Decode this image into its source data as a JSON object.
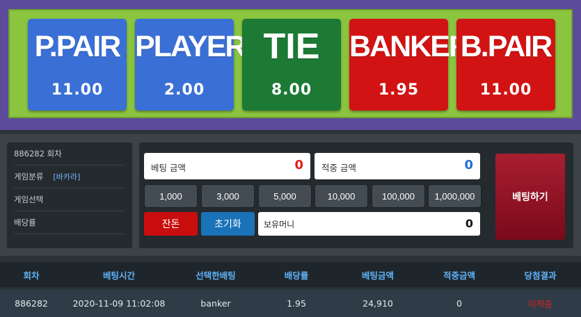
{
  "bet_board": {
    "options": [
      {
        "name": "P.PAIR",
        "odds": "11.00",
        "color": "#3a6fd6"
      },
      {
        "name": "PLAYER",
        "odds": "2.00",
        "color": "#3a6fd6"
      },
      {
        "name": "TIE",
        "odds": "8.00",
        "color": "#1c7a35"
      },
      {
        "name": "BANKER",
        "odds": "1.95",
        "color": "#d11313"
      },
      {
        "name": "B.PAIR",
        "odds": "11.00",
        "color": "#d11313"
      }
    ]
  },
  "info": {
    "round": "886282 회차",
    "category_label": "게임분류",
    "category_value": "[바카라]",
    "selection_label": "게임선택",
    "odds_label": "배당률"
  },
  "betting": {
    "bet_amount_label": "베팅 금액",
    "bet_amount_value": "0",
    "bet_amount_color": "#e0201a",
    "win_amount_label": "적중 금액",
    "win_amount_value": "0",
    "win_amount_color": "#1f6fd6",
    "chips": [
      "1,000",
      "3,000",
      "5,000",
      "10,000",
      "100,000",
      "1,000,000"
    ],
    "change_label": "잔돈",
    "reset_label": "초기화",
    "holdings_label": "보유머니",
    "holdings_value": "0",
    "place_bet_label": "베팅하기"
  },
  "history": {
    "headers": [
      "회차",
      "베팅시간",
      "선택한배팅",
      "배당률",
      "베팅금액",
      "적중금액",
      "당첨결과"
    ],
    "rows": [
      [
        "886282",
        "2020-11-09 11:02:08",
        "banker",
        "1.95",
        "24,910",
        "0",
        "미적중"
      ]
    ],
    "result_color": "#e0201a"
  }
}
